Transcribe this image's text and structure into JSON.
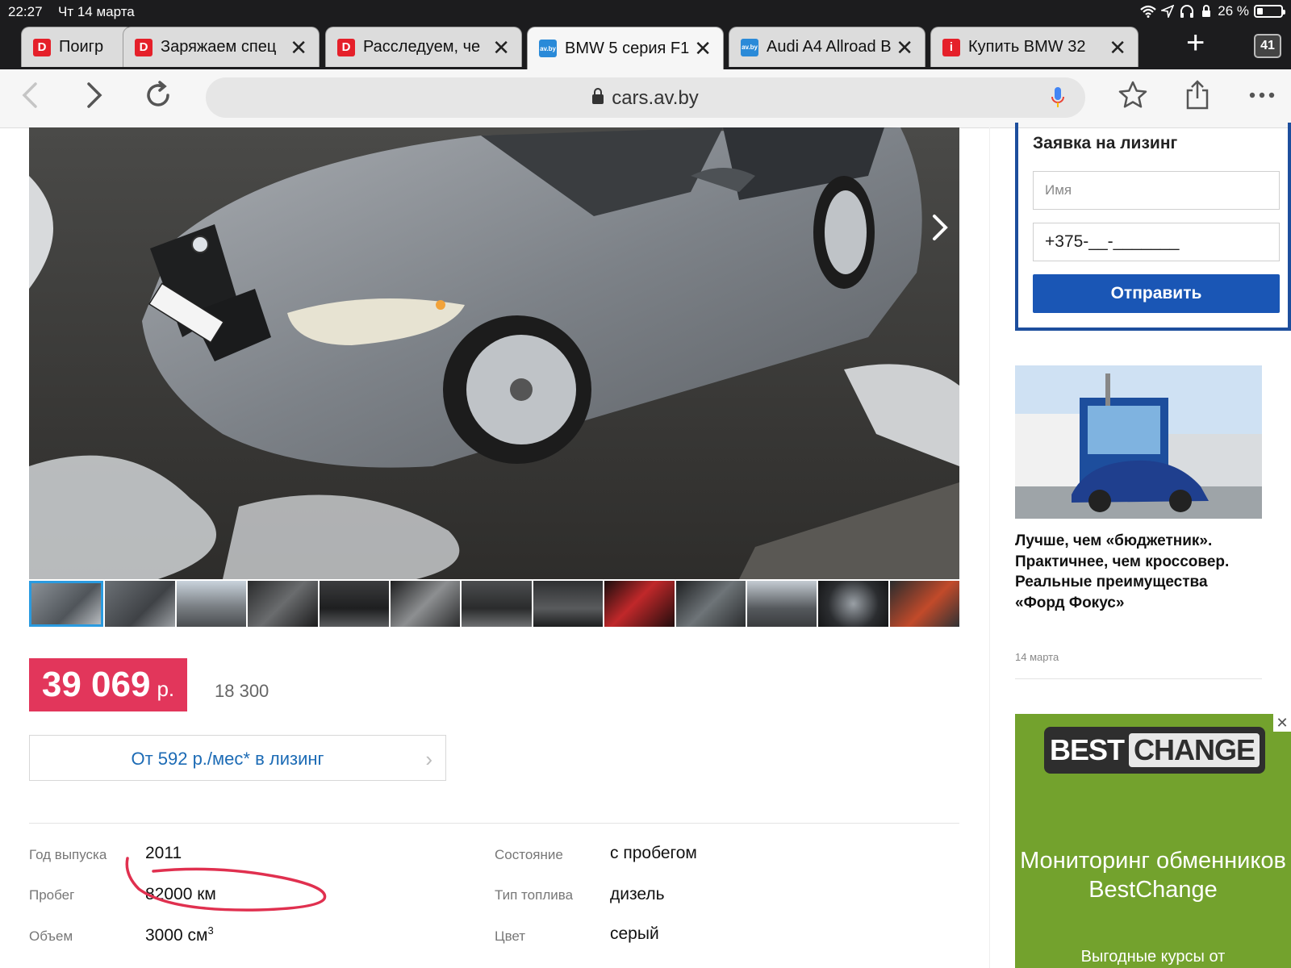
{
  "status_bar": {
    "time": "22:27",
    "date": "Чт 14 марта",
    "battery": "26 %"
  },
  "tabs": [
    {
      "title": "Поигр",
      "favicon": "red",
      "favicon_letter": "D"
    },
    {
      "title": "Заряжаем спец",
      "favicon": "red",
      "favicon_letter": "D"
    },
    {
      "title": "Расследуем, че",
      "favicon": "red",
      "favicon_letter": "D"
    },
    {
      "title": "BMW 5 серия F1",
      "favicon": "blue",
      "favicon_letter": "av.by",
      "active": true
    },
    {
      "title": "Audi A4 Allroad B",
      "favicon": "blue",
      "favicon_letter": "av.by"
    },
    {
      "title": "Купить BMW 32",
      "favicon": "red",
      "favicon_letter": "i"
    }
  ],
  "tab_count": "41",
  "address_bar": {
    "url": "cars.av.by"
  },
  "listing": {
    "price": "39 069",
    "currency": "р.",
    "price_usd": "18 300",
    "leasing_label": "От 592 р./мес* в лизинг",
    "thumbnail_count": 13,
    "active_thumbnail": 0,
    "specs": {
      "year_label": "Год выпуска",
      "year": "2011",
      "mileage_label": "Пробег",
      "mileage": "82000 км",
      "volume_label": "Объем",
      "volume": "3000 см",
      "volume_sup": "3",
      "condition_label": "Состояние",
      "condition": "с пробегом",
      "fuel_label": "Тип топлива",
      "fuel": "дизель",
      "color_label": "Цвет",
      "color": "серый"
    }
  },
  "lease_form": {
    "title": "Заявка на лизинг",
    "name_placeholder": "Имя",
    "phone_value": "+375-__-_______",
    "submit_label": "Отправить"
  },
  "news": {
    "title": "Лучше, чем «бюджетник». Практичнее, чем кроссовер. Реальные преимущества «Форд Фокус»",
    "date": "14 марта"
  },
  "ad": {
    "logo_best": "BEST",
    "logo_change": "CHANGE",
    "text": "Мониторинг обменников BestChange",
    "sub": "Выгодные курсы от",
    "close": "✕"
  },
  "colors": {
    "price_badge": "#e2365b",
    "brand_blue": "#1a56b5",
    "ad_green": "#73a22d",
    "annotation_red": "#e0304f"
  }
}
